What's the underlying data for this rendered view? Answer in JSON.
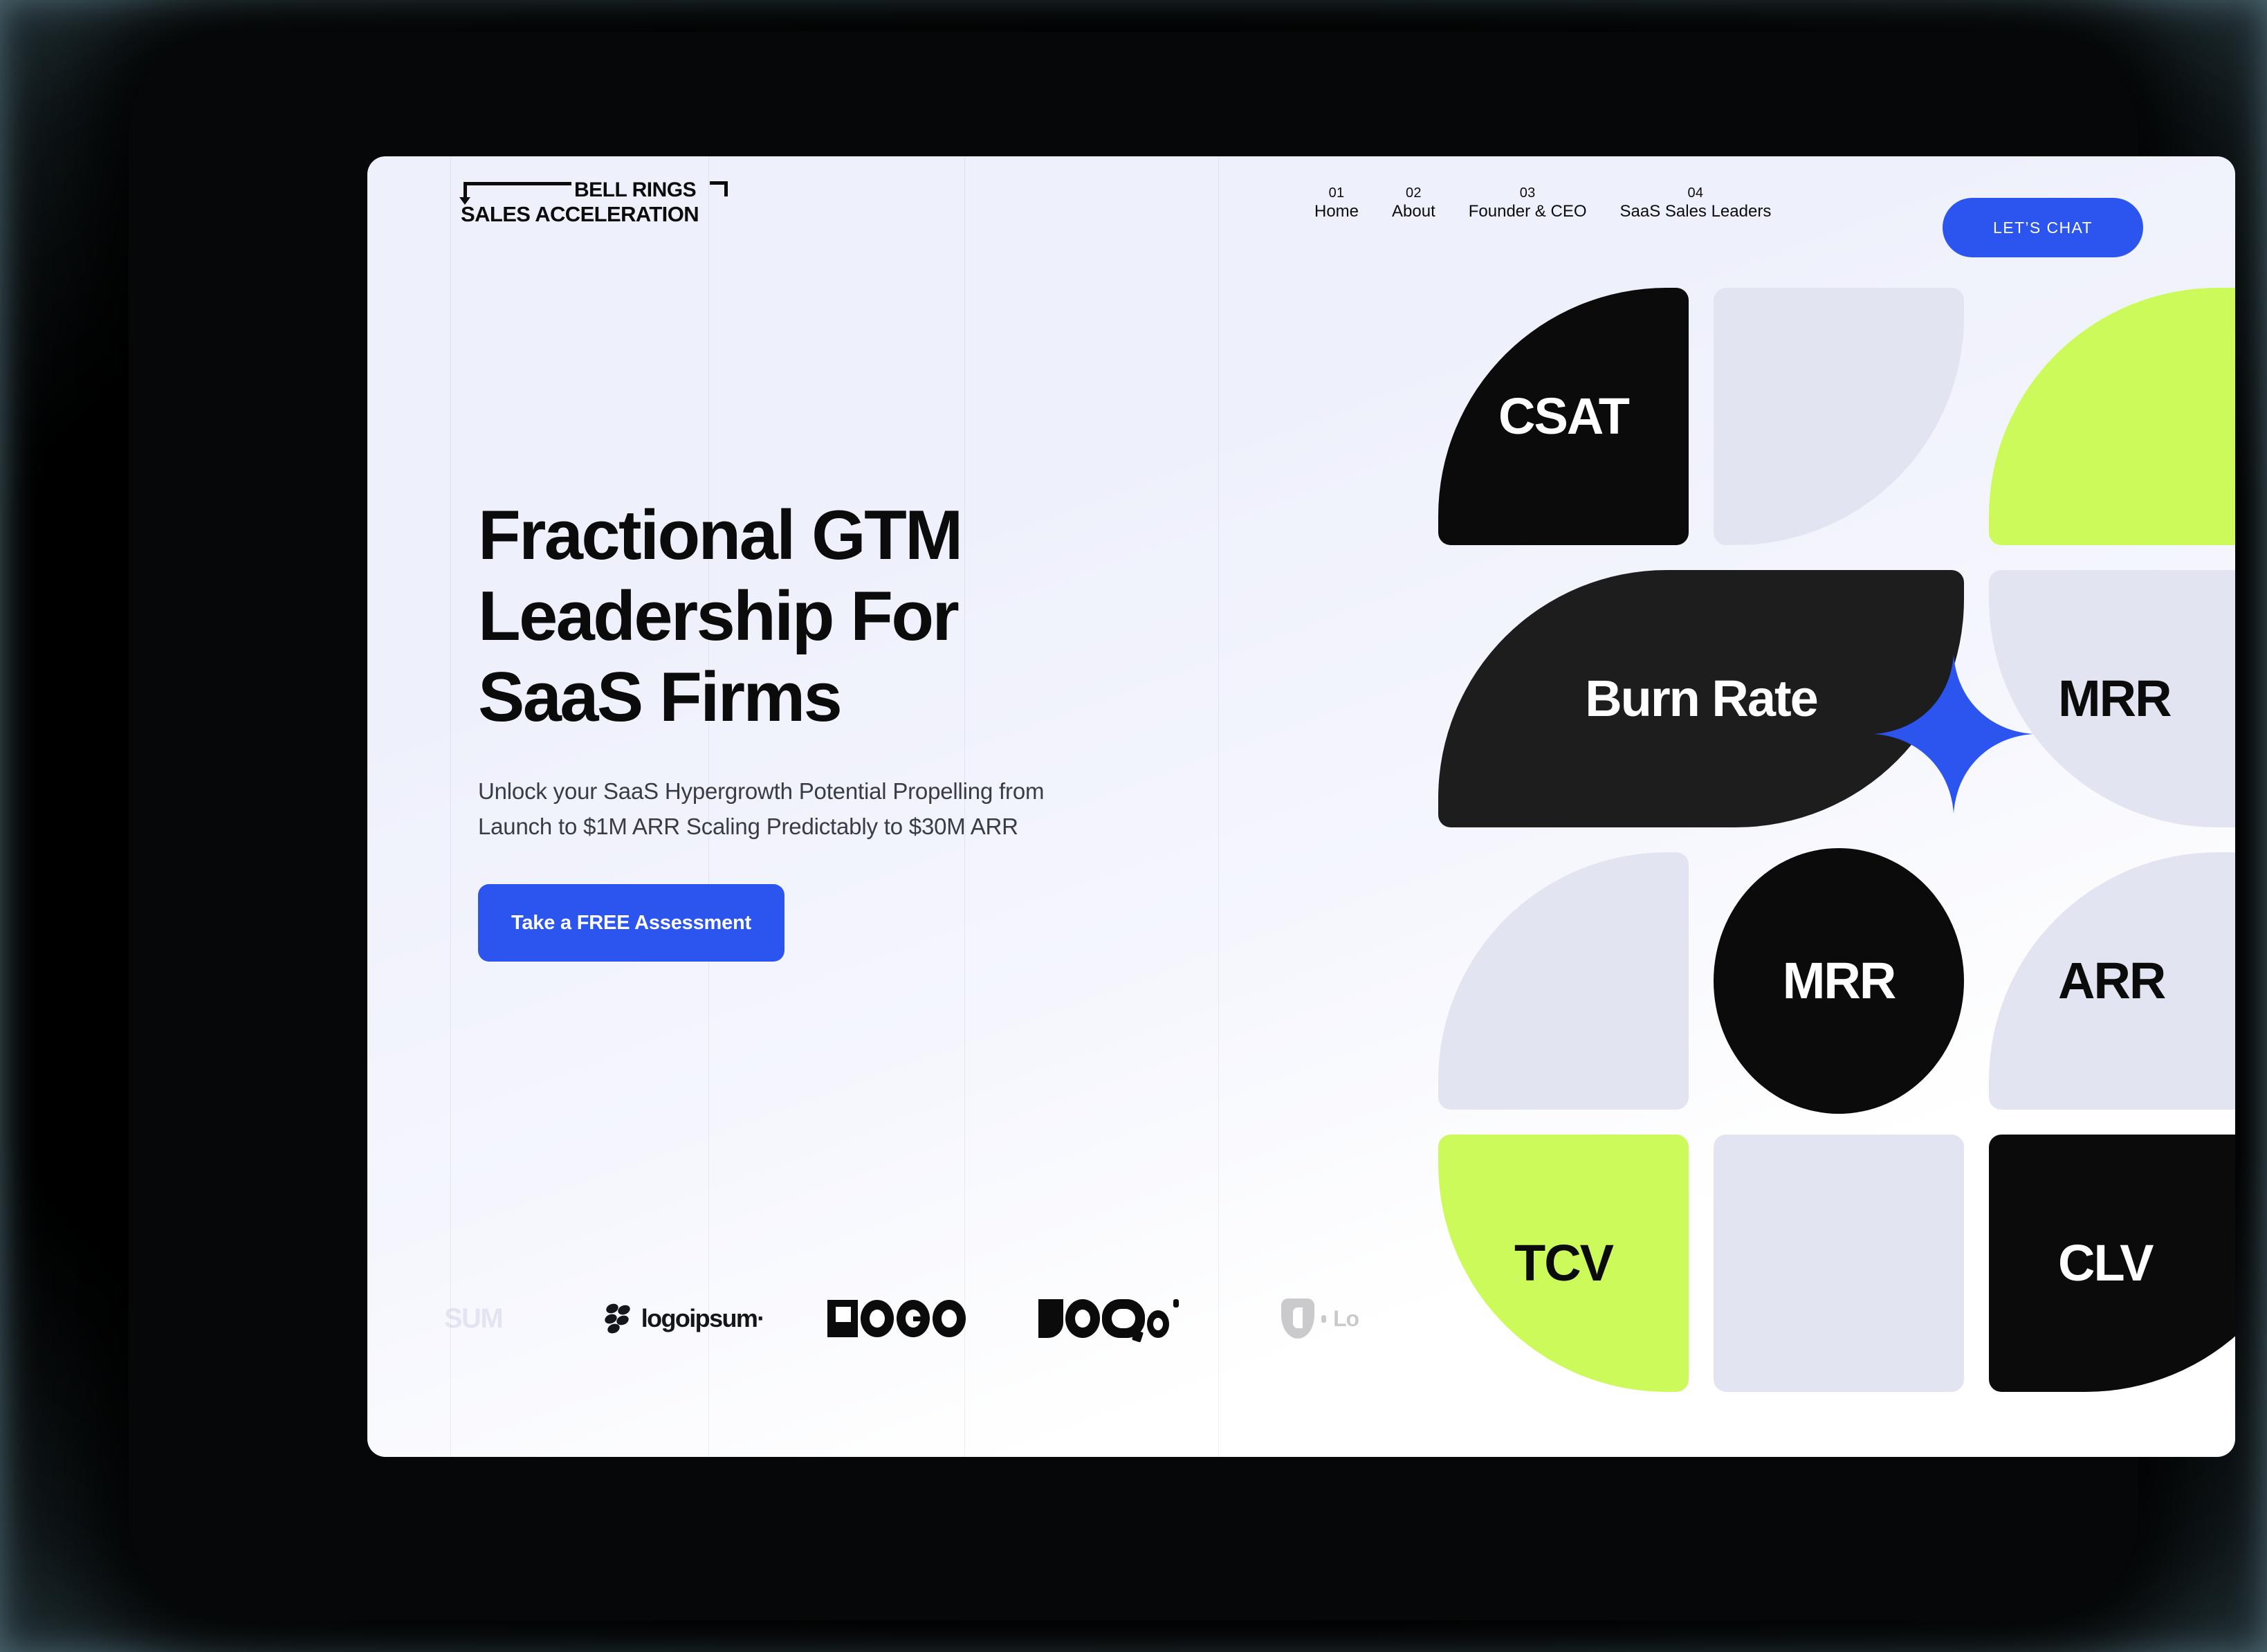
{
  "brand": {
    "line1": "BELL RINGS",
    "line2": "SALES ACCELERATION"
  },
  "nav": {
    "items": [
      {
        "num": "01",
        "label": "Home"
      },
      {
        "num": "02",
        "label": "About"
      },
      {
        "num": "03",
        "label": "Founder & CEO"
      },
      {
        "num": "04",
        "label": "SaaS Sales Leaders"
      }
    ],
    "cta_label": "LET’S CHAT"
  },
  "hero": {
    "title": "Fractional GTM\nLeadership For\nSaaS Firms",
    "subtitle": "Unlock your SaaS Hypergrowth Potential Propelling from\nLaunch to $1M ARR Scaling Predictably to $30M ARR",
    "cta_label": "Take a FREE Assessment"
  },
  "logo_strip": {
    "items": [
      {
        "name": "logoipsum-partial",
        "text": "SUM",
        "style": "faded-text"
      },
      {
        "name": "logoipsum-wordmark",
        "text": "logoipsum",
        "style": "wordmark"
      },
      {
        "name": "logo-blocky",
        "text": "LOGO",
        "style": "blocky"
      },
      {
        "name": "logo-rounded",
        "text": "LOQO",
        "style": "rounded"
      },
      {
        "name": "logo-shield",
        "text": "Lo",
        "style": "shield"
      }
    ]
  },
  "metrics": {
    "tiles": [
      {
        "label": "CSAT",
        "color": "dark"
      },
      {
        "label": "",
        "color": "grey"
      },
      {
        "label": "",
        "color": "lime"
      },
      {
        "label": "Burn Rate",
        "color": "charcoal"
      },
      {
        "label": "MRR",
        "color": "grey"
      },
      {
        "label": "",
        "color": "grey"
      },
      {
        "label": "MRR",
        "color": "dark"
      },
      {
        "label": "ARR",
        "color": "grey"
      },
      {
        "label": "TCV",
        "color": "lime"
      },
      {
        "label": "",
        "color": "grey"
      },
      {
        "label": "CLV",
        "color": "dark"
      }
    ],
    "sparkle_name": "sparkle-star"
  },
  "colors": {
    "accent_blue": "#2B55EE",
    "lime": "#CCFA5A",
    "dark": "#0B0B0B",
    "charcoal": "#1D1D1D",
    "grey_tile": "#E2E4F2",
    "page_bg": "#EEF0FB",
    "desk_bg": "#4E6A74"
  }
}
